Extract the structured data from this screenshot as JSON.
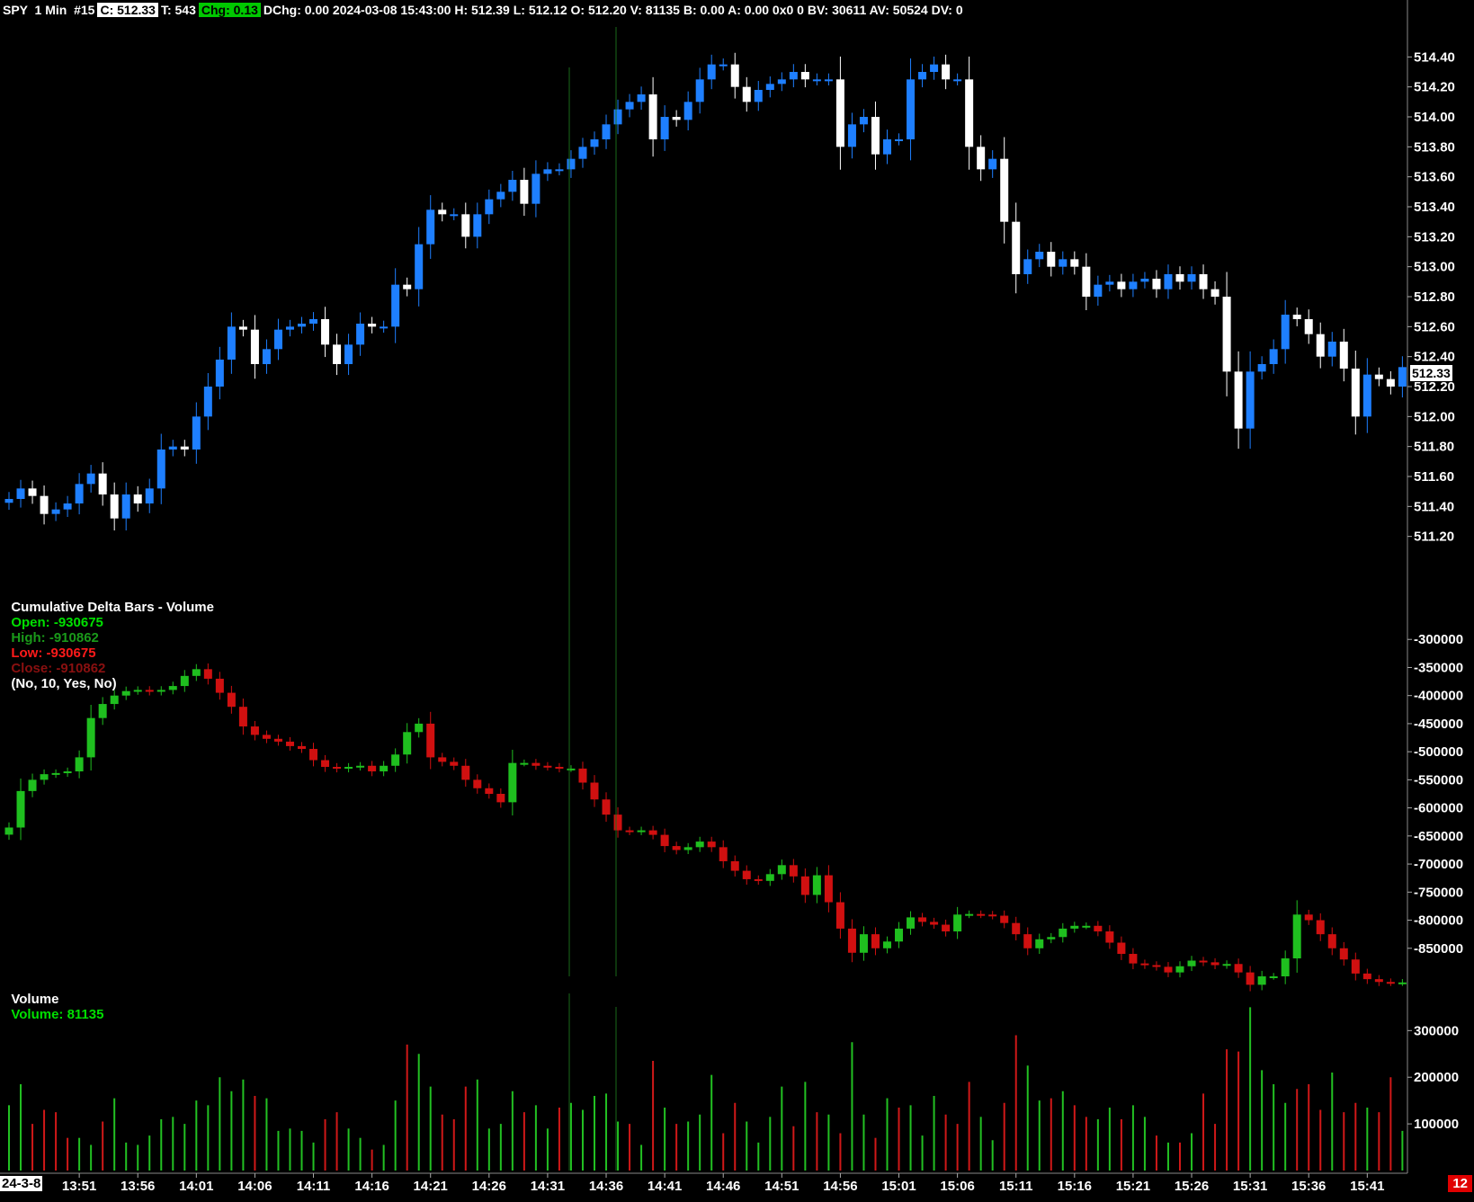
{
  "header": {
    "symbol": "SPY  1 Min  #15",
    "close": "C: 512.33",
    "trades": "T: 543",
    "chg": "Chg: 0.13",
    "rest": "DChg: 0.00 2024-03-08 15:43:00 H: 512.39 L: 512.12 O: 512.20 V: 81135 B: 0.00 A: 0.00 0x0 0 BV: 30611 AV: 50524 DV: 0"
  },
  "delta_title": {
    "name": "Cumulative Delta Bars - Volume",
    "open": "Open: -930675",
    "high": "High: -910862",
    "low": "Low: -930675",
    "close": "Close: -910862",
    "params": "(No, 10, Yes, No)"
  },
  "volume_title": {
    "name": "Volume",
    "value": "Volume: 81135"
  },
  "current_price_label": "512.33",
  "corner_date": "24-3-8",
  "badge": "12",
  "colors": {
    "up_price": "#1e7fff",
    "down_price": "#ffffff",
    "up_delta": "#1fbf1f",
    "down_delta": "#d01010",
    "vol_up": "#22c022",
    "vol_down": "#d01818",
    "marker": "#1a6a1a"
  },
  "chart_data": [
    {
      "type": "candlestick",
      "title": "SPY 1 Min",
      "ylim": [
        511.0,
        514.6
      ],
      "yticks": [
        "514.40",
        "514.20",
        "514.00",
        "513.80",
        "513.60",
        "513.40",
        "513.20",
        "513.00",
        "512.80",
        "512.60",
        "512.40",
        "512.20",
        "512.00",
        "511.80",
        "511.60",
        "511.40",
        "511.20"
      ],
      "close": [
        511.45,
        511.52,
        511.47,
        511.35,
        511.38,
        511.42,
        511.55,
        511.62,
        511.48,
        511.32,
        511.48,
        511.42,
        511.52,
        511.78,
        511.8,
        511.78,
        512.0,
        512.2,
        512.38,
        512.6,
        512.58,
        512.35,
        512.45,
        512.58,
        512.6,
        512.62,
        512.65,
        512.48,
        512.35,
        512.48,
        512.62,
        512.6,
        512.6,
        512.88,
        512.85,
        513.15,
        513.38,
        513.35,
        513.35,
        513.2,
        513.35,
        513.45,
        513.5,
        513.58,
        513.42,
        513.62,
        513.65,
        513.65,
        513.72,
        513.8,
        513.85,
        513.95,
        514.05,
        514.1,
        514.15,
        513.85,
        514.0,
        513.98,
        514.1,
        514.25,
        514.35,
        514.35,
        514.2,
        514.1,
        514.18,
        514.22,
        514.25,
        514.3,
        514.25,
        514.25,
        514.25,
        513.8,
        513.95,
        514.0,
        513.75,
        513.85,
        513.85,
        514.25,
        514.3,
        514.35,
        514.25,
        514.25,
        513.8,
        513.65,
        513.72,
        513.3,
        512.95,
        513.05,
        513.1,
        513.0,
        513.05,
        513.0,
        512.8,
        512.88,
        512.9,
        512.85,
        512.9,
        512.92,
        512.85,
        512.95,
        512.9,
        512.95,
        512.85,
        512.8,
        512.3,
        511.92,
        512.3,
        512.35,
        512.45,
        512.68,
        512.65,
        512.55,
        512.4,
        512.5,
        512.32,
        512.0,
        512.28,
        512.25,
        512.2,
        512.33
      ],
      "volume": [
        140000,
        185000,
        100000,
        130000,
        125000,
        70000,
        70000,
        55000,
        105000,
        155000,
        60000,
        55000,
        75000,
        110000,
        115000,
        100000,
        150000,
        140000,
        200000,
        170000,
        195000,
        160000,
        155000,
        85000,
        90000,
        85000,
        60000,
        110000,
        125000,
        90000,
        70000,
        45000,
        55000,
        150000,
        270000,
        250000,
        180000,
        120000,
        110000,
        180000,
        195000,
        90000,
        100000,
        170000,
        125000,
        140000,
        90000,
        135000,
        145000,
        130000,
        160000,
        165000,
        105000,
        100000,
        55000,
        235000,
        135000,
        100000,
        105000,
        120000,
        205000,
        80000,
        145000,
        105000,
        60000,
        115000,
        180000,
        95000,
        190000,
        125000,
        120000,
        80000,
        275000,
        120000,
        70000,
        155000,
        135000,
        140000,
        75000,
        160000,
        120000,
        100000,
        190000,
        115000,
        65000,
        145000,
        290000,
        225000,
        150000,
        155000,
        170000,
        140000,
        115000,
        110000,
        135000,
        110000,
        140000,
        115000,
        75000,
        60000,
        60000,
        80000,
        165000,
        100000,
        260000,
        255000,
        350000,
        215000,
        185000,
        145000,
        175000,
        185000,
        130000,
        210000,
        125000,
        145000,
        135000,
        125000,
        200000,
        85000
      ],
      "vol_up": [
        1,
        1,
        0,
        0,
        0,
        0,
        1,
        1,
        0,
        1,
        1,
        1,
        1,
        1,
        1,
        1,
        1,
        1,
        1,
        1,
        1,
        0,
        1,
        1,
        1,
        1,
        1,
        0,
        0,
        1,
        1,
        0,
        1,
        1,
        0,
        1,
        1,
        0,
        0,
        0,
        1,
        1,
        1,
        1,
        0,
        1,
        1,
        0,
        1,
        1,
        1,
        1,
        1,
        0,
        1,
        0,
        1,
        0,
        1,
        1,
        1,
        0,
        0,
        1,
        1,
        1,
        1,
        0,
        1,
        0,
        1,
        0,
        1,
        1,
        0,
        1,
        0,
        1,
        1,
        1,
        0,
        0,
        0,
        1,
        1,
        0,
        0,
        1,
        1,
        0,
        1,
        0,
        0,
        1,
        1,
        0,
        1,
        1,
        0,
        1,
        0,
        1,
        0,
        0,
        0,
        0,
        1,
        1,
        1,
        1,
        0,
        0,
        0,
        1,
        0,
        0,
        1,
        0,
        0,
        1
      ]
    },
    {
      "type": "candlestick",
      "title": "Cumulative Delta Bars - Volume",
      "ylim": [
        -900000,
        -250000
      ],
      "yticks": [
        "-300000",
        "-350000",
        "-400000",
        "-450000",
        "-500000",
        "-550000",
        "-600000",
        "-650000",
        "-700000",
        "-750000",
        "-800000",
        "-850000"
      ],
      "close": [
        -635000,
        -570000,
        -550000,
        -540000,
        -538000,
        -535000,
        -510000,
        -440000,
        -415000,
        -400000,
        -392000,
        -390000,
        -393000,
        -390000,
        -383000,
        -365000,
        -353000,
        -370000,
        -395000,
        -420000,
        -455000,
        -470000,
        -477000,
        -482000,
        -490000,
        -495000,
        -515000,
        -527000,
        -530000,
        -527000,
        -525000,
        -535000,
        -525000,
        -505000,
        -465000,
        -450000,
        -510000,
        -518000,
        -525000,
        -550000,
        -565000,
        -575000,
        -590000,
        -520000,
        -520000,
        -525000,
        -527000,
        -530000,
        -530000,
        -555000,
        -585000,
        -612000,
        -640000,
        -642000,
        -640000,
        -648000,
        -668000,
        -675000,
        -670000,
        -660000,
        -670000,
        -695000,
        -712000,
        -727000,
        -730000,
        -718000,
        -702000,
        -722000,
        -755000,
        -720000,
        -768000,
        -815000,
        -858000,
        -825000,
        -850000,
        -838000,
        -815000,
        -795000,
        -803000,
        -808000,
        -820000,
        -790000,
        -789000,
        -790000,
        -792000,
        -805000,
        -825000,
        -850000,
        -834000,
        -830000,
        -815000,
        -810000,
        -810000,
        -820000,
        -840000,
        -860000,
        -877000,
        -880000,
        -883000,
        -893000,
        -882000,
        -872000,
        -875000,
        -880000,
        -878000,
        -893000,
        -915000,
        -900000,
        -900000,
        -868000,
        -790000,
        -800000,
        -825000,
        -850000,
        -870000,
        -895000,
        -905000,
        -910000,
        -911000,
        -910862
      ]
    },
    {
      "type": "bar",
      "title": "Volume",
      "yticks": [
        "300000",
        "200000",
        "100000"
      ],
      "ylim": [
        0,
        370000
      ],
      "last_value": 81135
    }
  ],
  "xaxis_labels": [
    "13:51",
    "13:56",
    "14:01",
    "14:06",
    "14:11",
    "14:16",
    "14:21",
    "14:26",
    "14:31",
    "14:36",
    "14:41",
    "14:46",
    "14:51",
    "14:56",
    "15:01",
    "15:06",
    "15:11",
    "15:16",
    "15:21",
    "15:26",
    "15:31",
    "15:36",
    "15:41"
  ]
}
